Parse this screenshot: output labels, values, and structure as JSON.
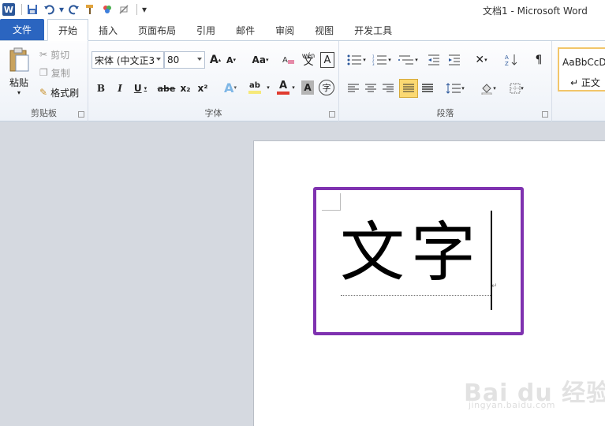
{
  "window": {
    "title": "文档1 - Microsoft Word"
  },
  "qat": {
    "icons": [
      "word-icon",
      "save-icon",
      "undo-icon",
      "redo-icon",
      "format-painter-icon",
      "color-icon",
      "clear-icon",
      "customize-icon"
    ]
  },
  "tabs": [
    {
      "label": "文件"
    },
    {
      "label": "开始"
    },
    {
      "label": "插入"
    },
    {
      "label": "页面布局"
    },
    {
      "label": "引用"
    },
    {
      "label": "邮件"
    },
    {
      "label": "审阅"
    },
    {
      "label": "视图"
    },
    {
      "label": "开发工具"
    }
  ],
  "clipboard": {
    "paste_label": "粘贴",
    "cut_label": "剪切",
    "copy_label": "复制",
    "format_painter_label": "格式刷",
    "group_label": "剪贴板"
  },
  "font": {
    "font_name": "宋体 (中文正3",
    "font_size": "80",
    "grow_label": "A",
    "shrink_label": "A",
    "change_case_label": "Aa",
    "phonetic_label": "wén",
    "border_label": "A",
    "bold_label": "B",
    "italic_label": "I",
    "underline_label": "U",
    "strike_label": "abe",
    "subscript_label": "x₂",
    "superscript_label": "x²",
    "effects_label": "A",
    "highlight_label": "ab",
    "font_color_label": "A",
    "shade_label": "A",
    "enclose_label": "字",
    "group_label": "字体"
  },
  "paragraph": {
    "group_label": "段落"
  },
  "styles": {
    "preview_label": "AaBbCcDd",
    "normal_label": "↵ 正文"
  },
  "document": {
    "text": "文字"
  },
  "watermark": {
    "brand": "Bai du 经验",
    "url": "jingyan.baidu.com"
  },
  "colors": {
    "file_tab": "#2b65c0",
    "frame": "#7f32b0",
    "highlight_yellow": "#f6e97a",
    "font_red": "#e03b2f"
  }
}
